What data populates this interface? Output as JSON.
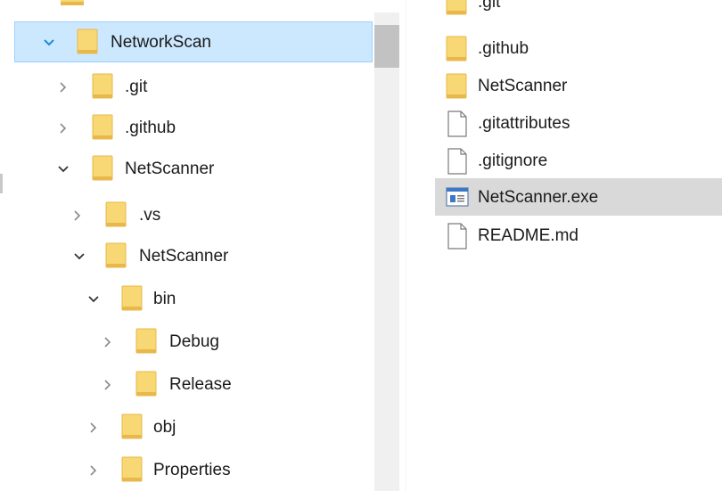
{
  "tree": {
    "items": [
      {
        "label": "NetworkScan",
        "expanded": true,
        "selected": true
      },
      {
        "label": ".git",
        "expanded": false
      },
      {
        "label": ".github",
        "expanded": false
      },
      {
        "label": "NetScanner",
        "expanded": true
      },
      {
        "label": ".vs",
        "expanded": false
      },
      {
        "label": "NetScanner",
        "expanded": true
      },
      {
        "label": "bin",
        "expanded": true
      },
      {
        "label": "Debug",
        "expanded": false
      },
      {
        "label": "Release",
        "expanded": false
      },
      {
        "label": "obj",
        "expanded": false
      },
      {
        "label": "Properties",
        "expanded": false
      }
    ]
  },
  "files": {
    "items": [
      {
        "label": ".git",
        "icon": "folder-icon"
      },
      {
        "label": ".github",
        "icon": "folder-icon"
      },
      {
        "label": "NetScanner",
        "icon": "folder-icon"
      },
      {
        "label": ".gitattributes",
        "icon": "file-icon"
      },
      {
        "label": ".gitignore",
        "icon": "file-icon"
      },
      {
        "label": "NetScanner.exe",
        "icon": "exe-icon",
        "hovered": true
      },
      {
        "label": "README.md",
        "icon": "file-icon"
      }
    ]
  },
  "colors": {
    "selection": "#cce8ff",
    "selection_border": "#99d1ff",
    "hover": "#d9d9d9",
    "folder": "#f8d775",
    "folder_dark": "#e8b84a"
  }
}
